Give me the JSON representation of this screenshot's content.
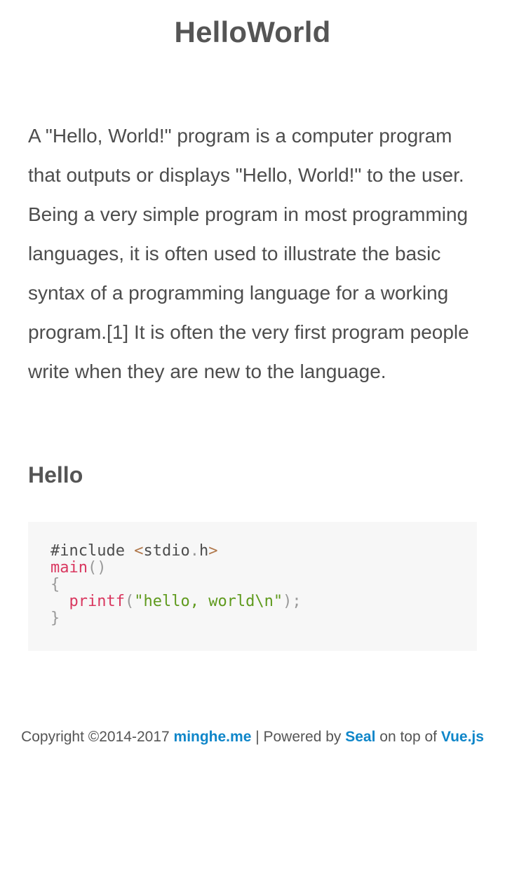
{
  "page": {
    "title": "HelloWorld"
  },
  "article": {
    "intro": "A \"Hello, World!\" program is a computer program that outputs or displays \"Hello, World!\" to the user. Being a very simple program in most programming languages, it is often used to illustrate the basic syntax of a programming language for a working program.[1] It is often the very first program people write when they are new to the language.",
    "section_heading": "Hello",
    "code": {
      "line1_directive": "#include ",
      "line1_lt": "<",
      "line1_file": "stdio",
      "line1_dot": ".",
      "line1_ext": "h",
      "line1_gt": ">",
      "line2_func": "main",
      "line2_parens": "()",
      "line3": "{",
      "line4_indent": "  ",
      "line4_func": "printf",
      "line4_open": "(",
      "line4_string": "\"hello, world\\n\"",
      "line4_close": ");",
      "line5": "}"
    }
  },
  "footer": {
    "copyright": "Copyright ©2014-2017 ",
    "site_link": "minghe.me",
    "separator": " | Powered by ",
    "seal_link": "Seal",
    "on_top_of": " on top of ",
    "vue_link": "Vue.js"
  },
  "colors": {
    "link": "#0f86c9",
    "code_background": "#f7f7f7",
    "code_function": "#d9375f",
    "code_string": "#5f9a1d",
    "code_include": "#b0774a"
  }
}
